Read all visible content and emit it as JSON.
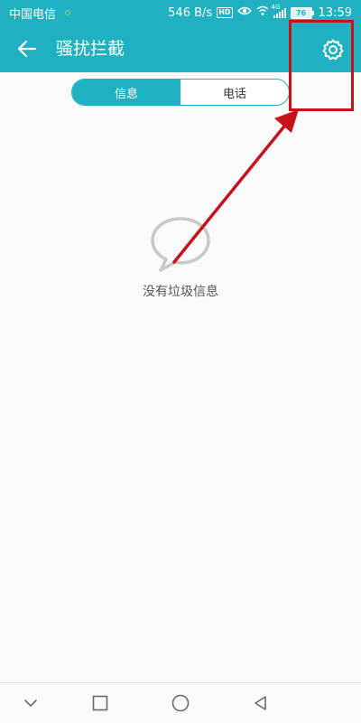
{
  "status_bar": {
    "carrier": "中国电信",
    "speed": "546 B/s",
    "hd_badge": "HD",
    "signal_tag": "4G",
    "battery": "76",
    "time": "13:59"
  },
  "app_bar": {
    "title": "骚扰拦截",
    "back_icon": "back-arrow-icon",
    "settings_icon": "gear-icon"
  },
  "tabs": [
    {
      "label": "信息",
      "active": true
    },
    {
      "label": "电话",
      "active": false
    }
  ],
  "empty_state": {
    "icon": "chat-bubble-icon",
    "message": "没有垃圾信息"
  },
  "nav_bar": {
    "icons": [
      "chevron-down-icon",
      "square-icon",
      "circle-icon",
      "triangle-back-icon"
    ]
  },
  "colors": {
    "primary": "#1fb1c2",
    "annotation": "#c8121b",
    "background": "#fafafa"
  }
}
